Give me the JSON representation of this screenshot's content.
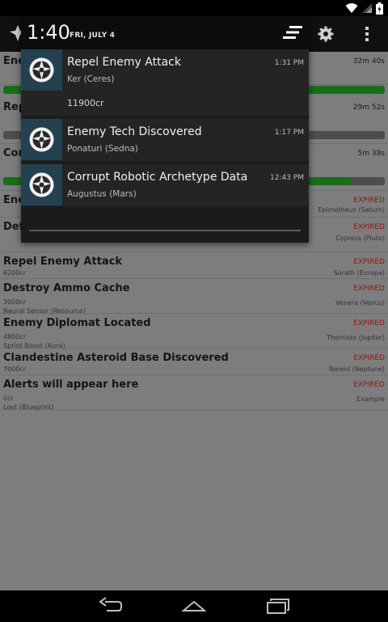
{
  "status_bar": {
    "icons": [
      "wifi-icon",
      "signal-icon",
      "battery-icon"
    ]
  },
  "app_bar": {
    "icons": [
      "warframe-logo-icon",
      "settings-icon",
      "overflow-menu-icon"
    ]
  },
  "alerts": [
    {
      "title": "Enemy",
      "credits": "",
      "reward": "",
      "status": "32m 40s",
      "location": "",
      "progress": 1.0
    },
    {
      "title": "Repel",
      "credits": "",
      "reward": "",
      "status": "29m 52s",
      "location": "",
      "progress": 0.0
    },
    {
      "title": "Corrupt",
      "credits": "",
      "reward": "",
      "status": "5m 38s",
      "location": "",
      "progress": 0.91
    },
    {
      "title": "Enemy",
      "credits": "",
      "reward": "",
      "status": "EXPIRED",
      "location": "Epimetheus (Saturn)"
    },
    {
      "title": "Defe",
      "credits": "",
      "reward": "",
      "status": "EXPIRED",
      "location": "Cypress (Pluto)"
    },
    {
      "title": "Repel Enemy Attack",
      "credits": "6200cr",
      "reward": "",
      "status": "EXPIRED",
      "location": "Sorath (Europa)"
    },
    {
      "title": "Destroy Ammo Cache",
      "credits": "3000cr",
      "reward": "Neural Sensor (Resource)",
      "status": "EXPIRED",
      "location": "Venera (Venus)"
    },
    {
      "title": "Enemy Diplomat Located",
      "credits": "4800cr",
      "reward": "Sprint Boost (Aura)",
      "status": "EXPIRED",
      "location": "Themisto (Jupiter)"
    },
    {
      "title": "Clandestine Asteroid Base Discovered",
      "credits": "7000cr",
      "reward": "",
      "status": "EXPIRED",
      "location": "Nereid (Neptune)"
    },
    {
      "title": "Alerts will appear here",
      "credits": "0cr",
      "reward": "Loot (Blueprint)",
      "status": "EXPIRED",
      "location": "Example"
    }
  ],
  "shade": {
    "time": "1:40",
    "date": "FRI, JULY 4",
    "clear_icon": "clear-all-icon",
    "notifications": [
      {
        "title": "Repel Enemy Attack",
        "subtitle": "Ker (Ceres)",
        "time": "1:31 PM",
        "expanded_text": "11900cr"
      },
      {
        "title": "Enemy Tech Discovered",
        "subtitle": "Ponaturi (Sedna)",
        "time": "1:17 PM"
      },
      {
        "title": "Corrupt Robotic Archetype Data",
        "subtitle": "Augustus (Mars)",
        "time": "12:43 PM"
      }
    ]
  },
  "nav_bar": {
    "icons": [
      "back-icon",
      "home-icon",
      "recents-icon"
    ]
  },
  "colors": {
    "accent_green": "#1a6e1a",
    "expired_red": "#8a1a14",
    "icon_bg": "#24414f"
  }
}
